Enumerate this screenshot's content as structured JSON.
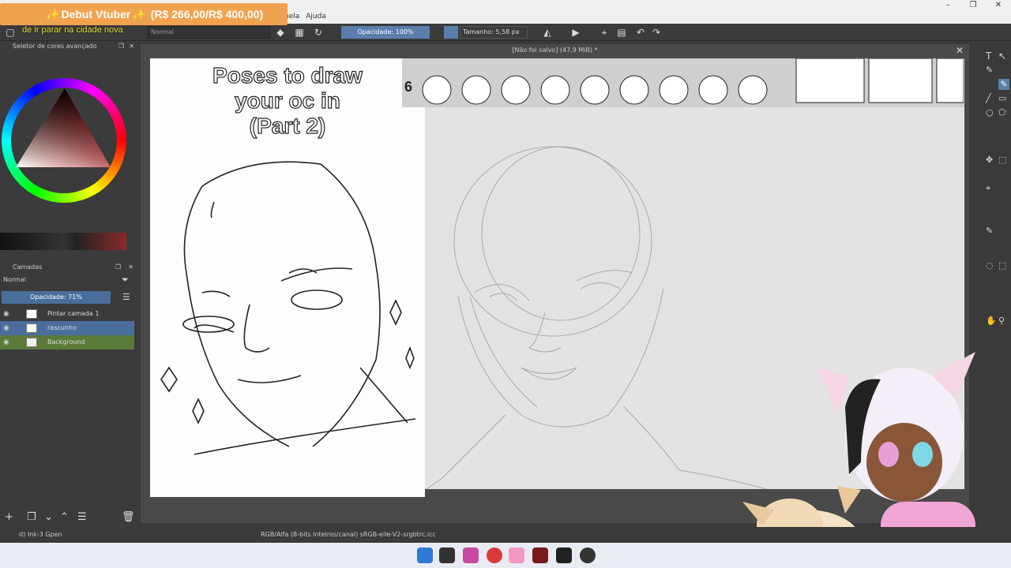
{
  "banner": {
    "star_left": "✨",
    "text": "Debut Vtuber",
    "star_right": "✨",
    "amount": "(R$ 266,00/R$ 400,00)"
  },
  "subtitle": "de ir parar na cidade nova",
  "menu": [
    "nela",
    "Ajuda"
  ],
  "window_controls": [
    "–",
    "❐",
    "✕"
  ],
  "toolbar": {
    "blend_mode": "Normal",
    "opacity": "Opacidade: 100%",
    "size": "Tamanho: 5,58 px"
  },
  "color_docker": {
    "title": "Seletor de cores avançado"
  },
  "layers_docker": {
    "title": "Camadas",
    "blend_mode": "Normal",
    "opacity": "Opacidade:  71%",
    "layers": [
      {
        "name": "Pintar camada 1"
      },
      {
        "name": "rascunho"
      },
      {
        "name": "Background"
      }
    ]
  },
  "canvas": {
    "title": "[Não foi salvo]  (47,9 MiB) *"
  },
  "reference": {
    "title_line1": "Poses to draw",
    "title_line2": "your oc in",
    "title_line3": "(Part 2)",
    "strip_number": "6"
  },
  "status": {
    "brush": "d) Ink-3 Gpen",
    "color_profile": "RGB/Alfa (8-bits inteiros/canal)  sRGB-elle-V2-srgbtrc.icc"
  },
  "colors": {
    "banner": "#f1a24f",
    "accent": "#5a7fae",
    "background_layer": "#5a7a3a",
    "active_layer": "#4a6e9c"
  }
}
